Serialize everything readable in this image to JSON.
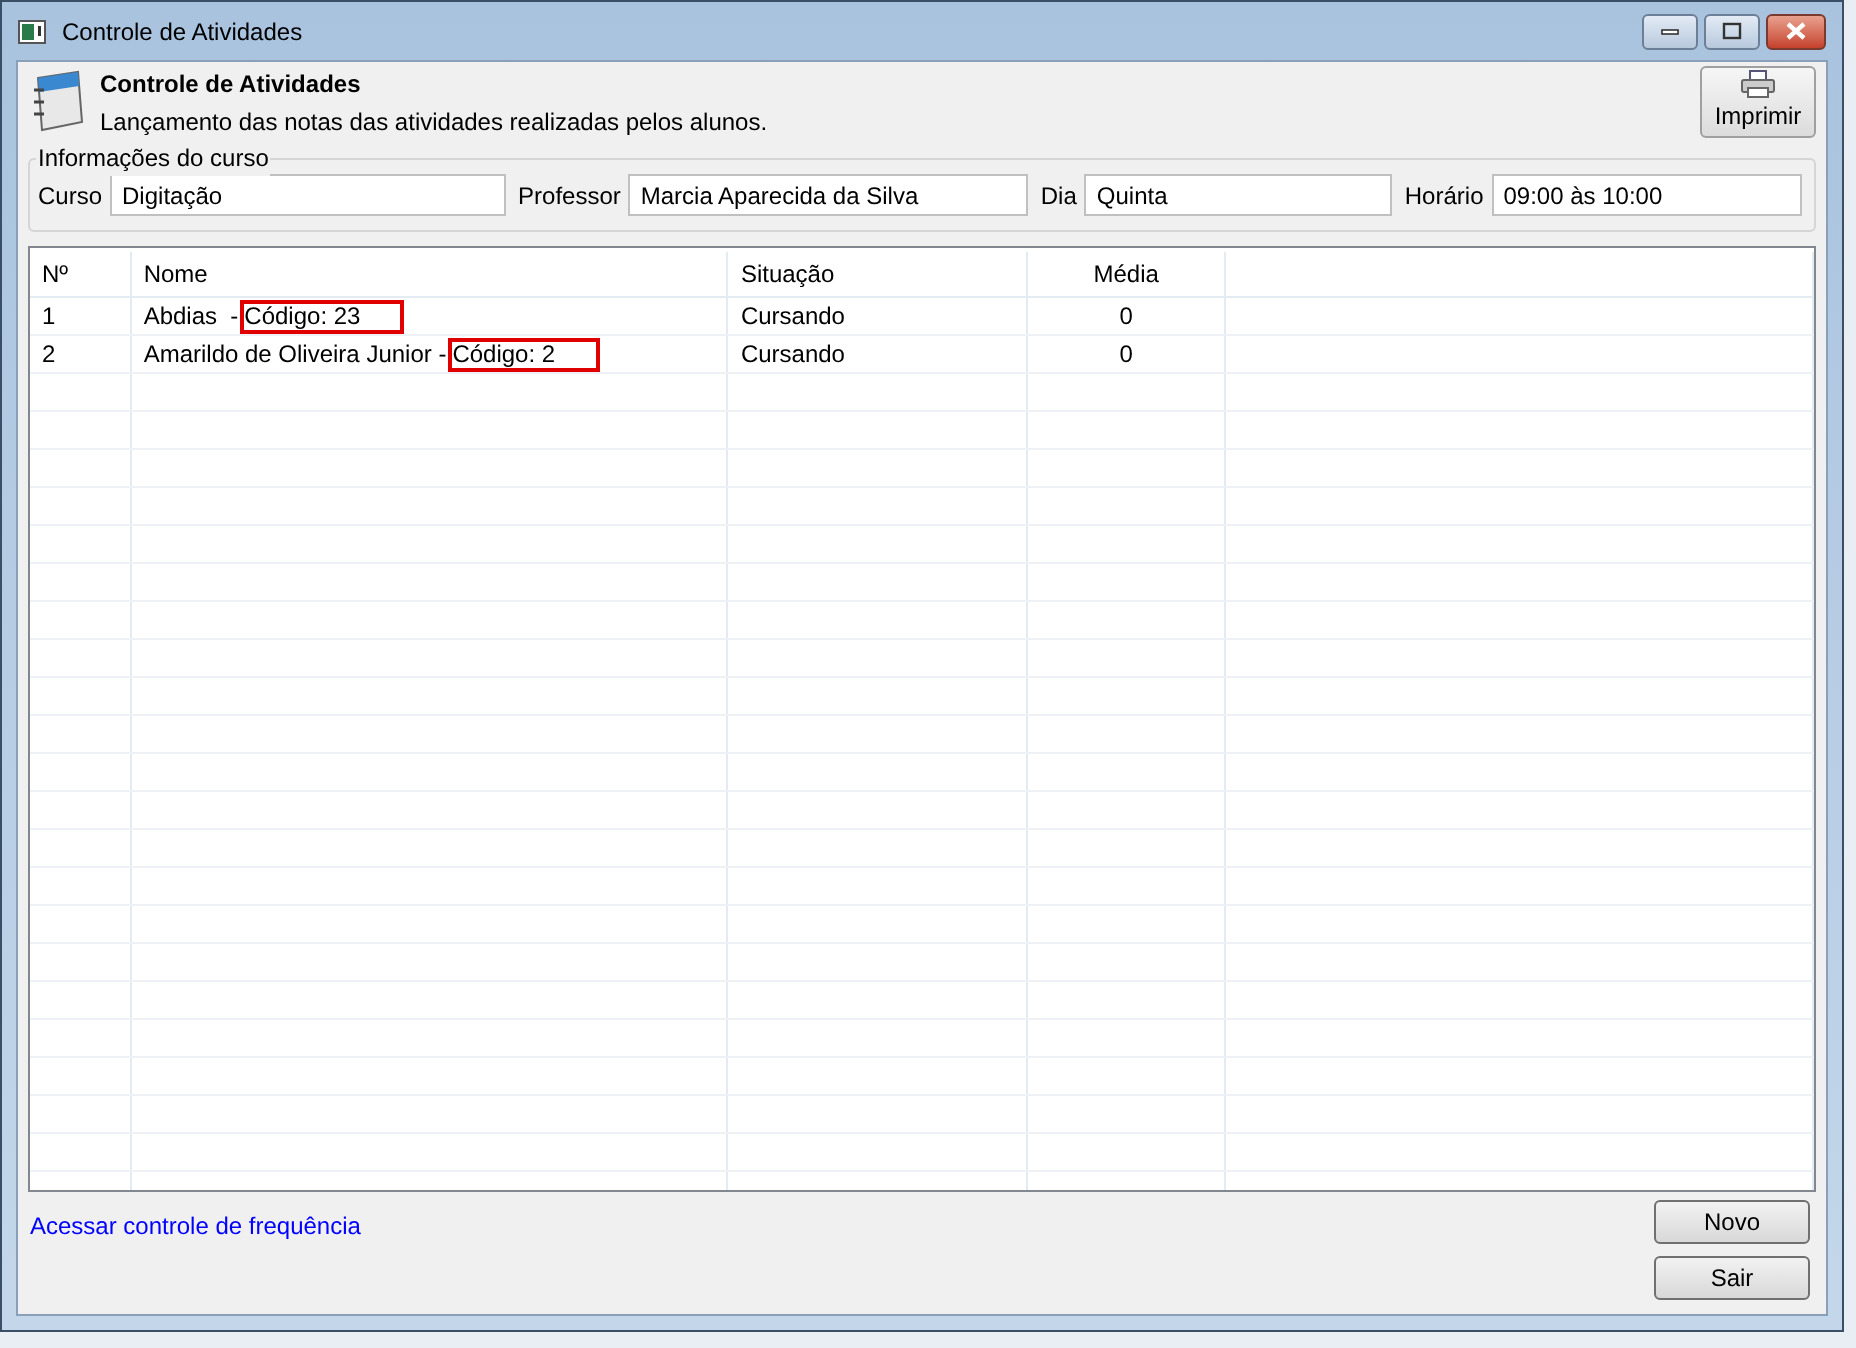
{
  "window": {
    "title": "Controle de Atividades"
  },
  "header": {
    "title": "Controle de Atividades",
    "subtitle": "Lançamento das notas das atividades realizadas pelos alunos.",
    "print_button": "Imprimir"
  },
  "course_info": {
    "legend": "Informações do curso",
    "fields": [
      {
        "label": "Curso",
        "value": "Digitação"
      },
      {
        "label": "Professor",
        "value": "Marcia Aparecida da Silva"
      },
      {
        "label": "Dia",
        "value": "Quinta"
      },
      {
        "label": "Horário",
        "value": "09:00 às 10:00"
      }
    ]
  },
  "table": {
    "columns": [
      "Nº",
      "Nome",
      "Situação",
      "Média"
    ],
    "rows": [
      {
        "number": "1",
        "name": "Abdias  -",
        "code": "Código: 23",
        "code_highlighted": true,
        "status": "Cursando",
        "average": "0"
      },
      {
        "number": "2",
        "name": "Amarildo de Oliveira Junior -",
        "code": "Código: 2",
        "code_highlighted": true,
        "status": "Cursando",
        "average": "0"
      }
    ]
  },
  "link": "Acessar controle de frequência",
  "buttons": [
    "Novo",
    "Sair"
  ]
}
